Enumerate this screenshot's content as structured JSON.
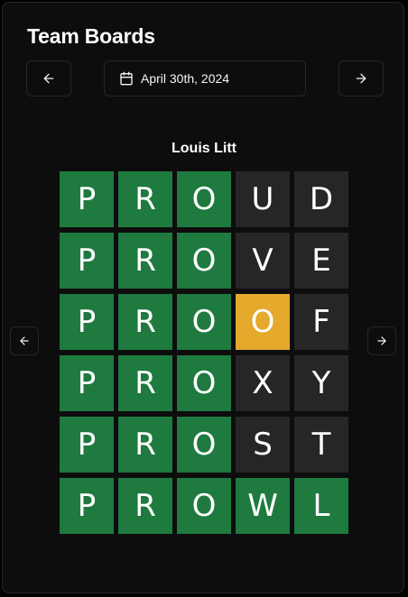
{
  "title": "Team Boards",
  "date_label": "April 30th, 2024",
  "player_name": "Louis Litt",
  "icons": {
    "prev_date": "arrow-left-icon",
    "next_date": "arrow-right-icon",
    "calendar": "calendar-icon",
    "prev_player": "arrow-left-icon",
    "next_player": "arrow-right-icon"
  },
  "colors": {
    "correct": "#1e7a3f",
    "present": "#e5a92b",
    "absent": "#262626"
  },
  "board": [
    [
      {
        "letter": "P",
        "state": "correct"
      },
      {
        "letter": "R",
        "state": "correct"
      },
      {
        "letter": "O",
        "state": "correct"
      },
      {
        "letter": "U",
        "state": "absent"
      },
      {
        "letter": "D",
        "state": "absent"
      }
    ],
    [
      {
        "letter": "P",
        "state": "correct"
      },
      {
        "letter": "R",
        "state": "correct"
      },
      {
        "letter": "O",
        "state": "correct"
      },
      {
        "letter": "V",
        "state": "absent"
      },
      {
        "letter": "E",
        "state": "absent"
      }
    ],
    [
      {
        "letter": "P",
        "state": "correct"
      },
      {
        "letter": "R",
        "state": "correct"
      },
      {
        "letter": "O",
        "state": "correct"
      },
      {
        "letter": "O",
        "state": "present"
      },
      {
        "letter": "F",
        "state": "absent"
      }
    ],
    [
      {
        "letter": "P",
        "state": "correct"
      },
      {
        "letter": "R",
        "state": "correct"
      },
      {
        "letter": "O",
        "state": "correct"
      },
      {
        "letter": "X",
        "state": "absent"
      },
      {
        "letter": "Y",
        "state": "absent"
      }
    ],
    [
      {
        "letter": "P",
        "state": "correct"
      },
      {
        "letter": "R",
        "state": "correct"
      },
      {
        "letter": "O",
        "state": "correct"
      },
      {
        "letter": "S",
        "state": "absent"
      },
      {
        "letter": "T",
        "state": "absent"
      }
    ],
    [
      {
        "letter": "P",
        "state": "correct"
      },
      {
        "letter": "R",
        "state": "correct"
      },
      {
        "letter": "O",
        "state": "correct"
      },
      {
        "letter": "W",
        "state": "correct"
      },
      {
        "letter": "L",
        "state": "correct"
      }
    ]
  ]
}
